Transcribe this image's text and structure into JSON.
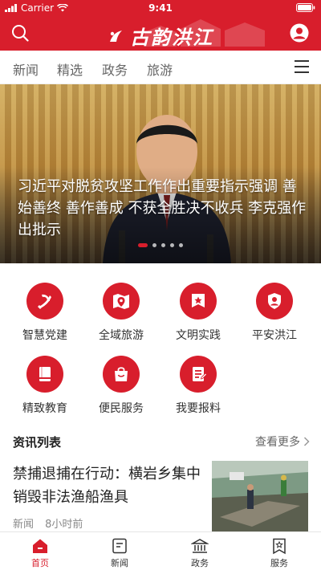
{
  "status_bar": {
    "carrier": "Carrier",
    "time": "9:41"
  },
  "header": {
    "logo_text": "古韵洪江"
  },
  "tabs": [
    {
      "label": "新闻"
    },
    {
      "label": "精选"
    },
    {
      "label": "政务"
    },
    {
      "label": "旅游"
    }
  ],
  "banner": {
    "caption": "习近平对脱贫攻坚工作作出重要指示强调 善始善终 善作善成 不获全胜决不收兵 李克强作出批示",
    "slide_count": 5,
    "active_slide": 1
  },
  "features": [
    {
      "label": "智慧党建",
      "icon": "party-emblem-icon"
    },
    {
      "label": "全域旅游",
      "icon": "map-pin-icon"
    },
    {
      "label": "文明实践",
      "icon": "star-banner-icon"
    },
    {
      "label": "平安洪江",
      "icon": "police-shield-icon"
    },
    {
      "label": "精致教育",
      "icon": "book-icon"
    },
    {
      "label": "便民服务",
      "icon": "shopping-bag-icon"
    },
    {
      "label": "我要报料",
      "icon": "report-document-icon"
    }
  ],
  "news_section": {
    "title": "资讯列表",
    "more_label": "查看更多"
  },
  "news": [
    {
      "title": "禁捕退捕在行动：横岩乡集中销毁非法渔船渔具",
      "category": "新闻",
      "time": "8小时前"
    }
  ],
  "bottom_nav": [
    {
      "label": "首页",
      "icon": "home-icon",
      "active": true
    },
    {
      "label": "新闻",
      "icon": "news-icon",
      "active": false
    },
    {
      "label": "政务",
      "icon": "government-icon",
      "active": false
    },
    {
      "label": "服务",
      "icon": "service-icon",
      "active": false
    }
  ],
  "colors": {
    "brand_red": "#d81e2c",
    "text_dark": "#222222",
    "text_muted": "#888888"
  }
}
